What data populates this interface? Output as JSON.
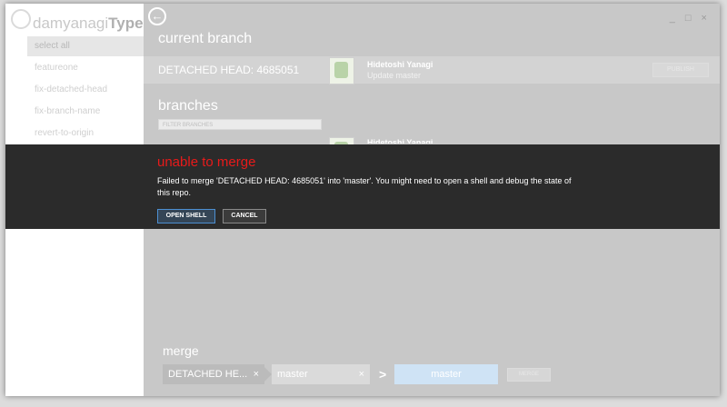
{
  "sidebar": {
    "title_prefix": "damyanagi",
    "title_bold": "TypeC",
    "items": [
      {
        "label": "select all"
      },
      {
        "label": "featureone"
      },
      {
        "label": "fix-detached-head"
      },
      {
        "label": "fix-branch-name"
      },
      {
        "label": "revert-to-origin"
      }
    ]
  },
  "window": {
    "controls": "_ □ ×"
  },
  "current_branch": {
    "heading": "current branch",
    "name": "DETACHED HEAD: 4685051",
    "author": "Hidetoshi Yanagi",
    "commit_message": "Update master",
    "publish_label": "PUBLISH"
  },
  "branches": {
    "heading": "branches",
    "filter_placeholder": "FILTER BRANCHES",
    "author": "Hidetoshi Yanagi"
  },
  "dialog": {
    "title": "unable to merge",
    "message": "Failed to merge 'DETACHED HEAD: 4685051' into 'master'. You might need to open a shell and debug the state of this repo.",
    "open_shell_label": "OPEN SHELL",
    "cancel_label": "CANCEL"
  },
  "merge": {
    "heading": "merge",
    "source": "DETACHED HE...",
    "destination": "master",
    "target": "master",
    "merge_label": "MERGE",
    "arrow": ">",
    "remove_glyph": "×"
  },
  "colors": {
    "accent_red": "#e81a1a",
    "dialog_bg": "#2b2b2b",
    "primary_border": "#4d8fd1"
  }
}
